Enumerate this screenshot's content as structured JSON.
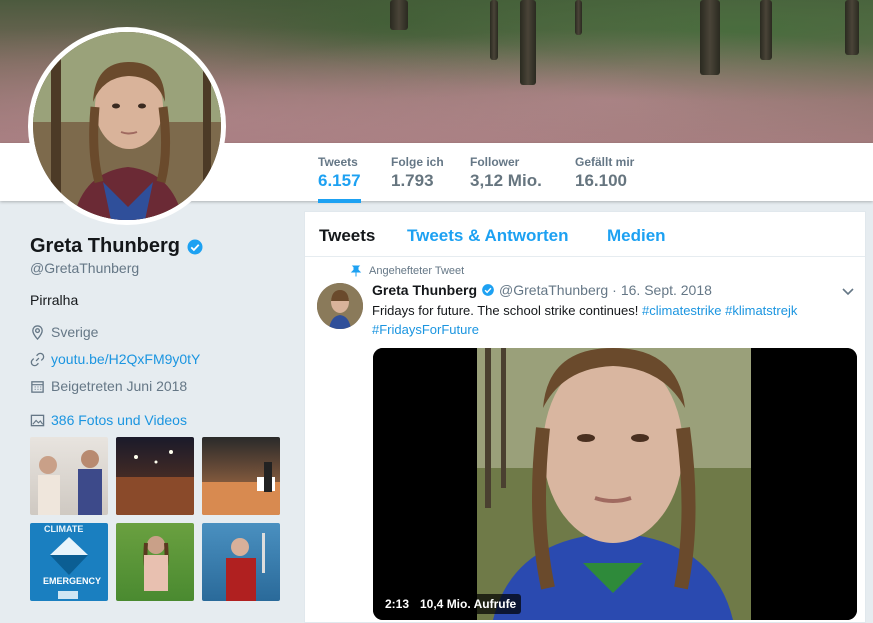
{
  "stats": [
    {
      "label": "Tweets",
      "value": "6.157",
      "active": true
    },
    {
      "label": "Folge ich",
      "value": "1.793",
      "active": false
    },
    {
      "label": "Follower",
      "value": "3,12 Mio.",
      "active": false
    },
    {
      "label": "Gefällt mir",
      "value": "16.100",
      "active": false
    }
  ],
  "profile": {
    "name": "Greta Thunberg",
    "handle": "@GretaThunberg",
    "bio": "Pirralha",
    "location": "Sverige",
    "website": "youtu.be/H2QxFM9y0tY",
    "joined": "Beigetreten Juni 2018",
    "photos_link": "386 Fotos und Videos"
  },
  "tabs": {
    "tweets": "Tweets",
    "replies": "Tweets & Antworten",
    "media": "Medien"
  },
  "tweet": {
    "pinned_label": "Angehefteter Tweet",
    "name": "Greta Thunberg",
    "handle": "@GretaThunberg",
    "sep": "·",
    "date": "16. Sept. 2018",
    "text": "Fridays for future. The school strike continues!",
    "tag1": "#climatestrike",
    "tag2": "#klimatstrejk",
    "tag3": "#FridaysForFuture",
    "video_duration": "2:13",
    "video_views": "10,4 Mio. Aufrufe"
  },
  "thumbs": {
    "t4_line1": "CLIMATE",
    "t4_line2": "EMERGENCY"
  },
  "colors": {
    "accent": "#1da1f2",
    "link": "#1b95e0",
    "verified": "#1da1f2"
  }
}
